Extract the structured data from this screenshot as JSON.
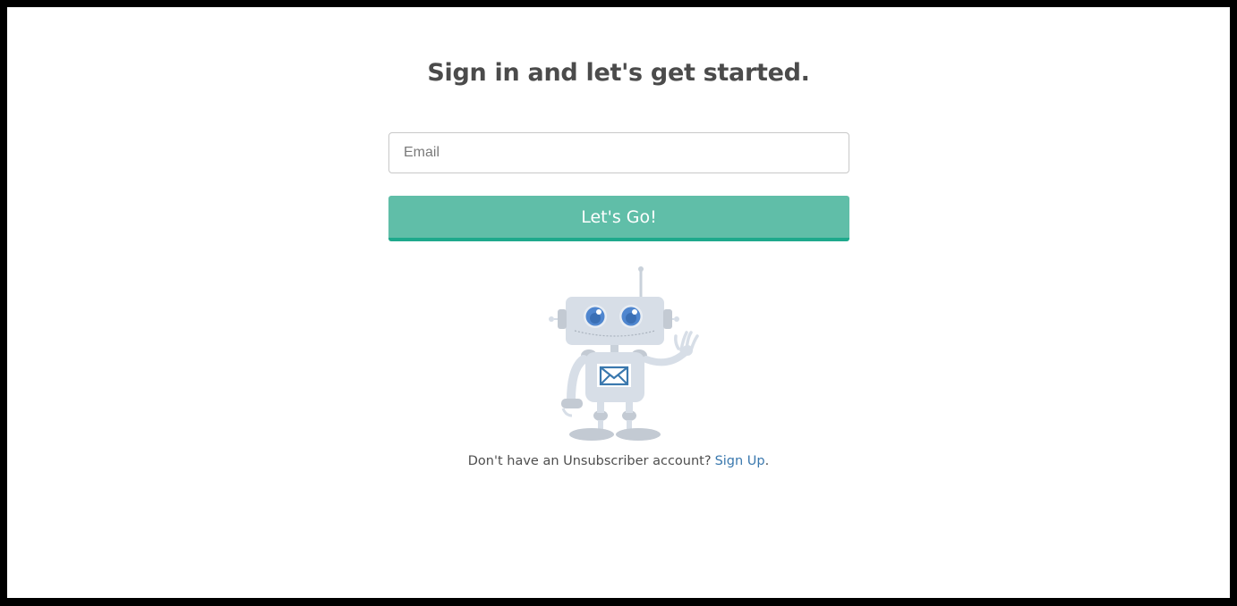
{
  "page": {
    "headline": "Sign in and let's get started."
  },
  "form": {
    "email_placeholder": "Email",
    "email_value": "",
    "submit_label": "Let's Go!"
  },
  "footer": {
    "prompt_text": "Don't have an Unsubscriber account?",
    "signup_link_label": "Sign Up",
    "trailing_period": "."
  },
  "illustration": {
    "name": "waving-robot-mascot",
    "chest_icon": "envelope-icon"
  },
  "colors": {
    "button_fill": "#60bea8",
    "button_border": "#1ea98c",
    "link": "#3a78ae",
    "headline_text": "#4b4b4b",
    "robot_body": "#d5dde6",
    "robot_eye": "#4f86cf"
  }
}
